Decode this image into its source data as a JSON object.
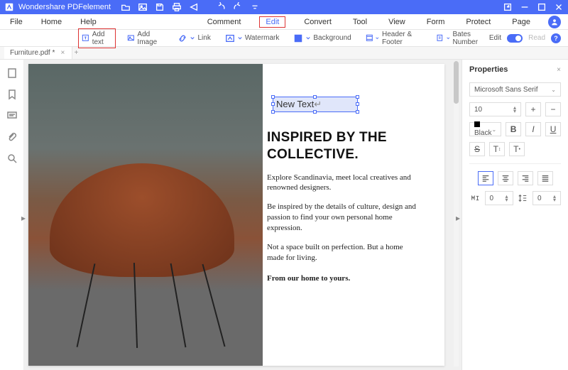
{
  "titlebar": {
    "app_name": "Wondershare PDFelement"
  },
  "menubar": {
    "left": [
      "File",
      "Home",
      "Help"
    ],
    "center": [
      "Comment",
      "Edit",
      "Convert",
      "Tool",
      "View",
      "Form",
      "Protect",
      "Page"
    ],
    "active": "Edit"
  },
  "toolbar": {
    "items": [
      {
        "label": "Add text",
        "highlight": true
      },
      {
        "label": "Add Image"
      },
      {
        "label": "Link"
      },
      {
        "label": "Watermark"
      },
      {
        "label": "Background"
      },
      {
        "label": "Header & Footer"
      },
      {
        "label": "Bates Number"
      }
    ],
    "edit_label": "Edit",
    "read_label": "Read"
  },
  "tab": {
    "name": "Furniture.pdf *"
  },
  "document": {
    "new_text": "New Text",
    "heading": "INSPIRED BY THE COLLECTIVE.",
    "para1": "Explore Scandinavia, meet local creatives and renowned designers.",
    "para2": "Be inspired by the details of culture, design and passion to find your own personal home expression.",
    "para3": "Not a space built on perfection. But a home made for living.",
    "closing": "From our home to yours."
  },
  "properties": {
    "title": "Properties",
    "font_family": "Microsoft Sans Serif",
    "font_size": "10",
    "color_label": "Black",
    "char_spacing": "0",
    "line_spacing": "0"
  }
}
